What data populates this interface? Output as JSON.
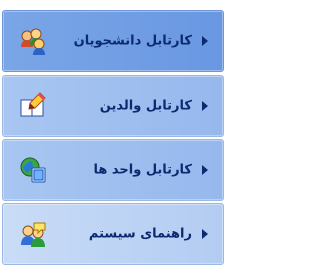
{
  "menu": {
    "items": [
      {
        "label": "کارتابل دانشجویان",
        "icon": "students-group-icon"
      },
      {
        "label": "کارتابل والدین",
        "icon": "book-pencil-icon"
      },
      {
        "label": "کارتابل واحد ها",
        "icon": "globe-window-icon"
      },
      {
        "label": "راهنمای سیستم",
        "icon": "users-help-icon"
      }
    ]
  },
  "colors": {
    "selected_bg": "#6f9ce3",
    "item_bg": "#a3c1f0",
    "last_item_bg": "#c4d7f5",
    "text": "#0b2a6f"
  }
}
